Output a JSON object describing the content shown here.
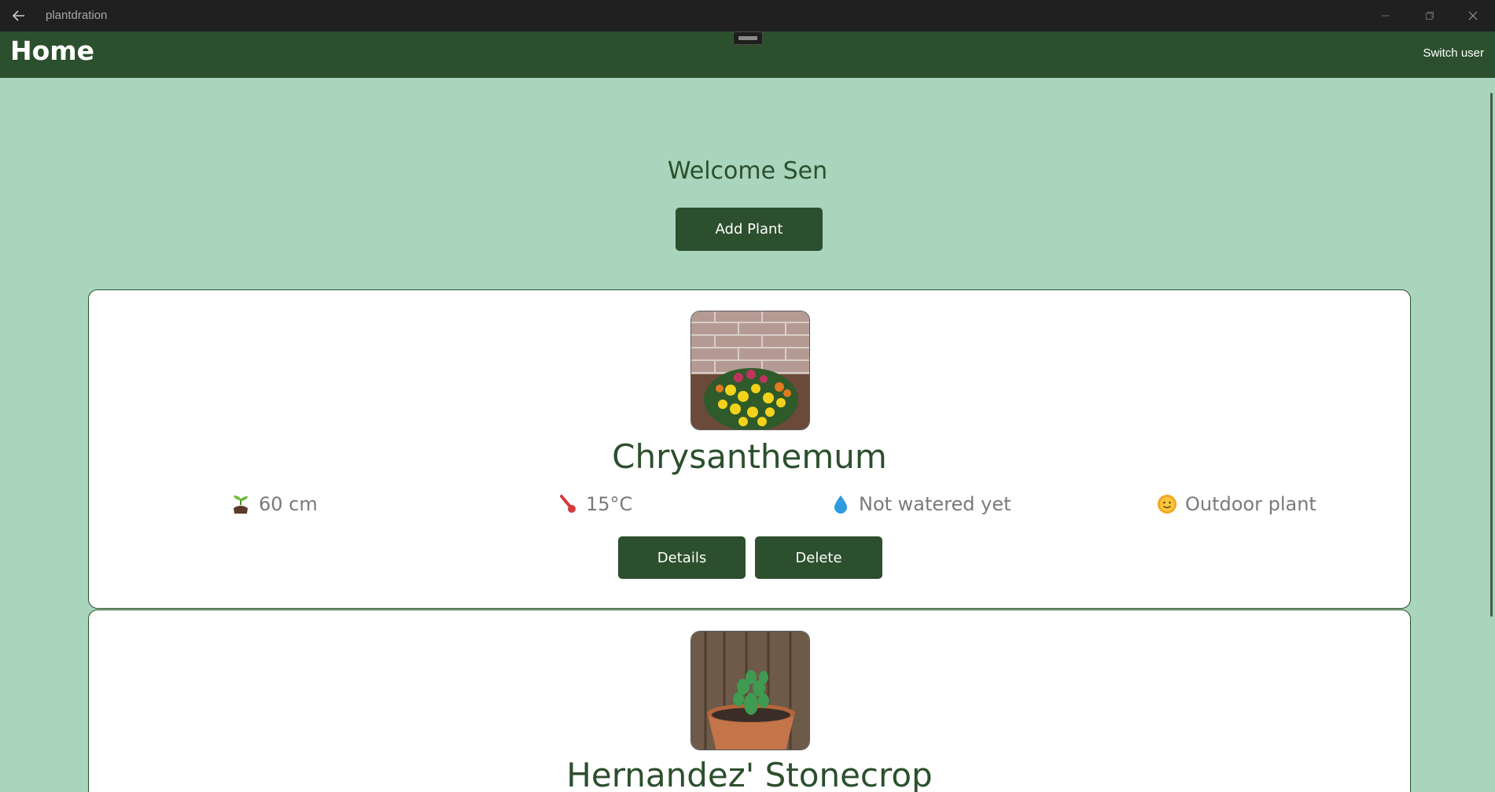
{
  "window": {
    "title": "plantdration"
  },
  "appbar": {
    "title": "Home",
    "switch_user": "Switch user"
  },
  "main": {
    "welcome": "Welcome Sen",
    "add_button": "Add Plant"
  },
  "plants": [
    {
      "name": "Chrysanthemum",
      "height": "60 cm",
      "temperature": "15°C",
      "watered": "Not watered yet",
      "location": "Outdoor plant",
      "details_label": "Details",
      "delete_label": "Delete"
    },
    {
      "name": "Hernandez' Stonecrop"
    }
  ],
  "colors": {
    "accent": "#2c4f2d",
    "background": "#a8d5bb",
    "card": "#ffffff",
    "titlebar": "#202020"
  },
  "icons": [
    "back-arrow-icon",
    "minimize-icon",
    "restore-icon",
    "close-icon",
    "seedling-icon",
    "thermometer-icon",
    "water-drop-icon",
    "sun-icon"
  ]
}
